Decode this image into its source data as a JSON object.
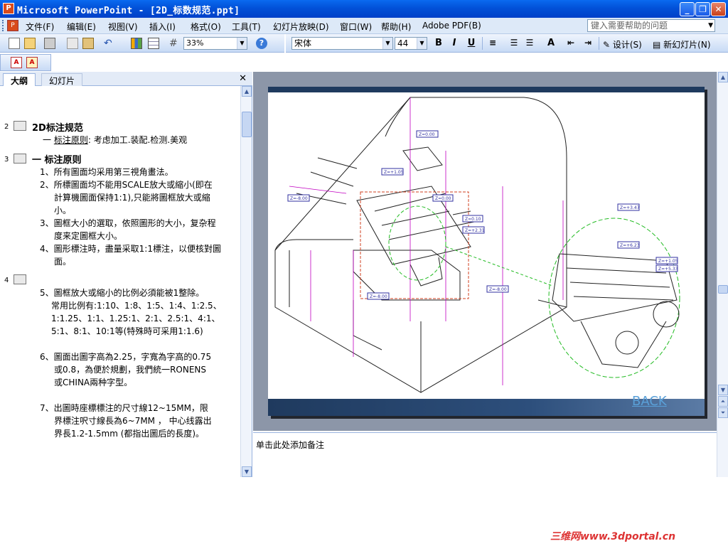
{
  "window": {
    "title": "Microsoft PowerPoint - [2D_标数规范.ppt]"
  },
  "menus": [
    "文件(F)",
    "编辑(E)",
    "视图(V)",
    "插入(I)",
    "格式(O)",
    "工具(T)",
    "幻灯片放映(D)",
    "窗口(W)",
    "帮助(H)",
    "Adobe PDF(B)"
  ],
  "help": {
    "placeholder": "键入需要帮助的问题"
  },
  "toolbar": {
    "zoom": "33%",
    "font": "宋体",
    "font_size": "44",
    "design_label": "设计(S)",
    "new_slide_label": "新幻灯片(N)"
  },
  "pane": {
    "tab_outline": "大纲",
    "tab_slides": "幻灯片"
  },
  "outline": {
    "s2_num": "2",
    "s2_title": "2D标注规范",
    "s2_l1_prefix": "一  ",
    "s2_l1_link": "标注原则",
    "s2_l1_rest": ": 考虑加工.装配.检测.美观",
    "s3_num": "3",
    "s3_title": "一  标注原则",
    "s3_l1": "1、所有圖面均采用第三視角畫法。",
    "s3_l2a": "2、所標圖面均不能用SCALE放大或縮小(即在",
    "s3_l2b": "計算機圖面保持1:1),只能將圖框放大或縮",
    "s3_l2c": "小。",
    "s3_l3a": "3、圖框大小的選取，依照圖形的大小，复杂程",
    "s3_l3b": "度来定圖框大小。",
    "s3_l4a": "4、圖形標注時，盡量采取1:1標注，以便核對圖",
    "s3_l4b": "面。",
    "s4_num": "4",
    "s4_l1": "5、圖框放大或縮小的比例必須能被1整除。",
    "s4_l2": "常用比例有:1:10、1:8、1:5、1:4、1:2.5、",
    "s4_l3": "1:1.25、1:1、1.25:1、2:1、2.5:1、4:1、",
    "s4_l4": "5:1、8:1、10:1等(特殊時可采用1:1.6)",
    "s4_l5": "6、圖面出圖字高為2.25，字寬為字高的0.75",
    "s4_l6": "或0.8，為便於規劃，我們統一RONENS",
    "s4_l7": "或CHINA兩种字型。",
    "s4_l8": "7、出圖時座標標注的尺寸線12~15MM，限",
    "s4_l9": "界標注呎寸線長為6~7MM ，  中心线露出",
    "s4_l10": "界長1.2-1.5mm (都指出圖后的長度)。"
  },
  "slide": {
    "back_label": "BACK",
    "labels": [
      "Z=0.00",
      "Z=+1.05",
      "Z=0.00",
      "Z=-8.00",
      "Z=0.10",
      "Z=+2.31",
      "Z=-8.00",
      "Z=-8.00",
      "Z=+3.47",
      "Z=+6.23",
      "Z=+1.05",
      "Z=+5.33"
    ]
  },
  "notes": {
    "placeholder": "单击此处添加备注"
  },
  "watermark": "三维网www.3dportal.cn"
}
